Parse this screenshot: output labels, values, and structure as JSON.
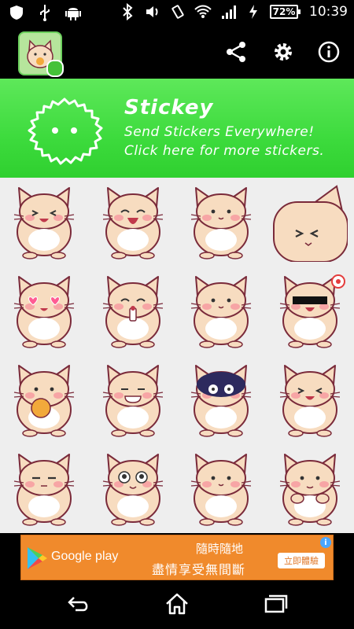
{
  "status_bar": {
    "left_icons": [
      "shield-icon",
      "usb-icon",
      "android-icon"
    ],
    "right_icons": [
      "bluetooth-icon",
      "volume-icon",
      "vibrate-icon",
      "wifi-icon",
      "signal-icon",
      "charging-icon"
    ],
    "battery": "72%",
    "time": "10:39"
  },
  "action_bar": {
    "icons": [
      "share-icon",
      "settings-icon",
      "info-icon"
    ]
  },
  "banner": {
    "title": "Stickey",
    "line1": "Send Stickers Everywhere!",
    "line2": "Click here for more stickers."
  },
  "stickers": [
    "cat-sticker-laughing",
    "cat-sticker-eating",
    "cat-sticker-smiling",
    "cat-sticker-closeup",
    "cat-sticker-heart-eyes",
    "cat-sticker-drinking",
    "cat-sticker-blushing",
    "cat-sticker-censored",
    "cat-sticker-cookie",
    "cat-sticker-grinning",
    "cat-sticker-gloomy",
    "cat-sticker-teary",
    "cat-sticker-annoyed",
    "cat-sticker-wide-eyed",
    "cat-sticker-happy",
    "cat-sticker-shy"
  ],
  "ad": {
    "store": "Google play",
    "line1": "隨時隨地",
    "line2": "盡情享受無間斷",
    "button": "立即體驗",
    "info": "i"
  },
  "nav": {
    "icons": [
      "back-icon",
      "home-icon",
      "recents-icon"
    ]
  },
  "colors": {
    "banner_green": "#3ddb3d",
    "grid_bg": "#eeeeee",
    "ad_orange": "#f08a2c",
    "cat_fur": "#f7dcc0",
    "cat_outline": "#7a2a3a"
  }
}
